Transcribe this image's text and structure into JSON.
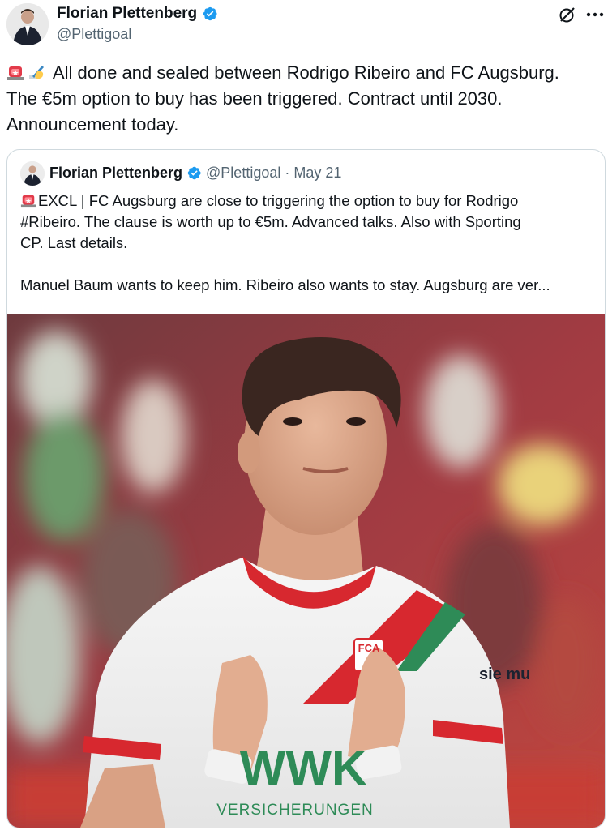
{
  "author": {
    "display_name": "Florian Plettenberg",
    "handle": "@Plettigoal"
  },
  "tweet": {
    "lines": [
      "All done and sealed between Rodrigo Ribeiro and FC Augsburg.",
      "The €5m option to buy has been triggered. Contract until 2030.",
      "Announcement today."
    ]
  },
  "quoted": {
    "display_name": "Florian Plettenberg",
    "handle": "@Plettigoal",
    "separator": "·",
    "date": "May 21",
    "paragraph1": [
      "EXCL | FC Augsburg are close to triggering the option to buy for Rodrigo",
      "#Ribeiro. The clause is worth up to €5m. Advanced talks. Also with Sporting",
      "CP.  Last details."
    ],
    "paragraph2": "Manuel Baum wants to keep him. Ribeiro also wants to stay. Augsburg are ver...",
    "jersey_text": {
      "sponsor": "WWK",
      "sponsor_sub": "VERSICHERUNGEN",
      "crest": "FCA",
      "sleeve": "sie mu"
    }
  },
  "icons": {
    "verified": "verified-badge-icon",
    "grok": "grok-icon",
    "more": "more-options-icon",
    "siren": "police-light-emoji",
    "writing": "writing-hand-emoji"
  },
  "colors": {
    "verified_blue": "#1d9bf0",
    "text": "#0f1419",
    "muted": "#536471",
    "border": "#cfd9de",
    "jersey_red": "#d7282f",
    "jersey_green": "#2e8b57"
  }
}
